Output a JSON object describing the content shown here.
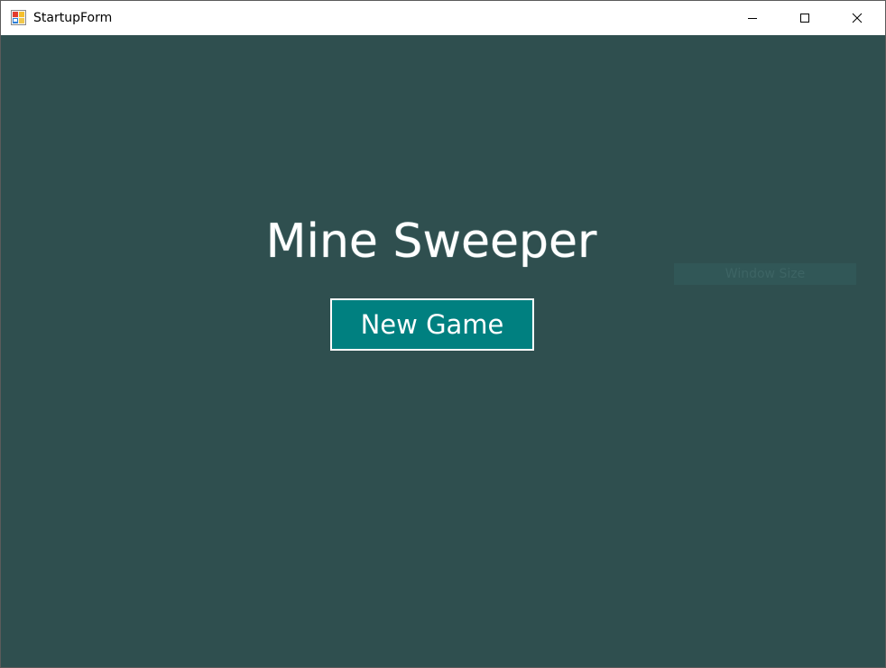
{
  "window": {
    "title": "StartupForm",
    "icon": "winforms-app-icon",
    "controls": {
      "minimize": "minimize-icon",
      "maximize": "maximize-icon",
      "close": "close-icon"
    }
  },
  "main": {
    "title": "Mine Sweeper",
    "new_game_label": "New Game",
    "ghost_label": "Window Size"
  },
  "colors": {
    "background": "#2f4f4f",
    "button": "#008080",
    "text": "#ffffff"
  }
}
